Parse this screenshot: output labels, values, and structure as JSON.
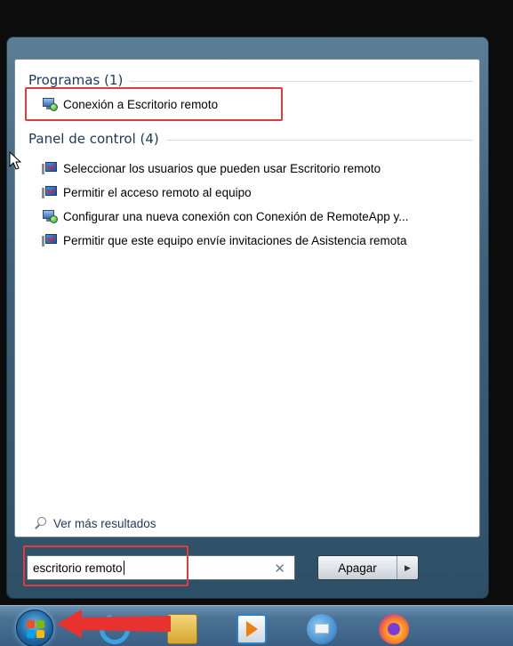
{
  "search_results": {
    "programs": {
      "header": "Programas (1)",
      "items": [
        {
          "label": "Conexión a Escritorio remoto",
          "icon": "remote-desktop-icon"
        }
      ]
    },
    "control_panel": {
      "header": "Panel de control (4)",
      "items": [
        {
          "label": "Seleccionar los usuarios que pueden usar Escritorio remoto",
          "icon": "system-icon"
        },
        {
          "label": "Permitir el acceso remoto al equipo",
          "icon": "system-icon"
        },
        {
          "label": "Configurar una nueva conexión con Conexión de RemoteApp y...",
          "icon": "remote-desktop-icon"
        },
        {
          "label": "Permitir que este equipo envíe invitaciones de Asistencia remota",
          "icon": "system-icon"
        }
      ]
    },
    "see_more": "Ver más resultados"
  },
  "search": {
    "value": "escritorio remoto",
    "clear_icon": "✕"
  },
  "shutdown": {
    "label": "Apagar",
    "arrow_icon": "▶"
  },
  "taskbar": {
    "icons": [
      "start-orb-icon",
      "internet-explorer-icon",
      "file-explorer-icon",
      "media-player-icon",
      "thunderbird-icon",
      "firefox-icon"
    ]
  },
  "colors": {
    "highlight": "#e03c3c",
    "header_text": "#1e395b"
  }
}
